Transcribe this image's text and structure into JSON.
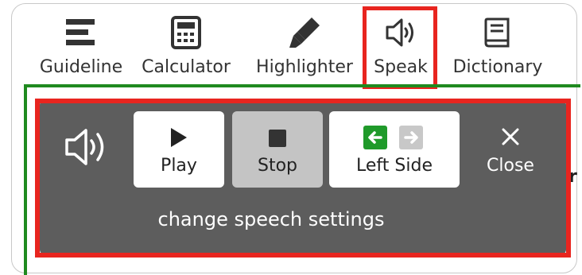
{
  "toolbar": {
    "items": [
      {
        "label": "Guideline",
        "icon": "guideline-icon"
      },
      {
        "label": "Calculator",
        "icon": "calculator-icon"
      },
      {
        "label": "Highlighter",
        "icon": "highlighter-icon"
      },
      {
        "label": "Speak",
        "icon": "speaker-icon"
      },
      {
        "label": "Dictionary",
        "icon": "book-icon"
      }
    ]
  },
  "speech_panel": {
    "icon": "speaker-icon",
    "play_label": "Play",
    "stop_label": "Stop",
    "left_side_label": "Left Side",
    "close_label": "Close",
    "settings_link": "change speech settings"
  },
  "colors": {
    "highlight": "#e8251f",
    "panel_bg": "#5d5d5d",
    "green_border": "#1f8a1f",
    "arrow_green": "#1f9a2a",
    "arrow_gray": "#c8c8c8"
  },
  "content": {
    "partial_text": "r"
  }
}
